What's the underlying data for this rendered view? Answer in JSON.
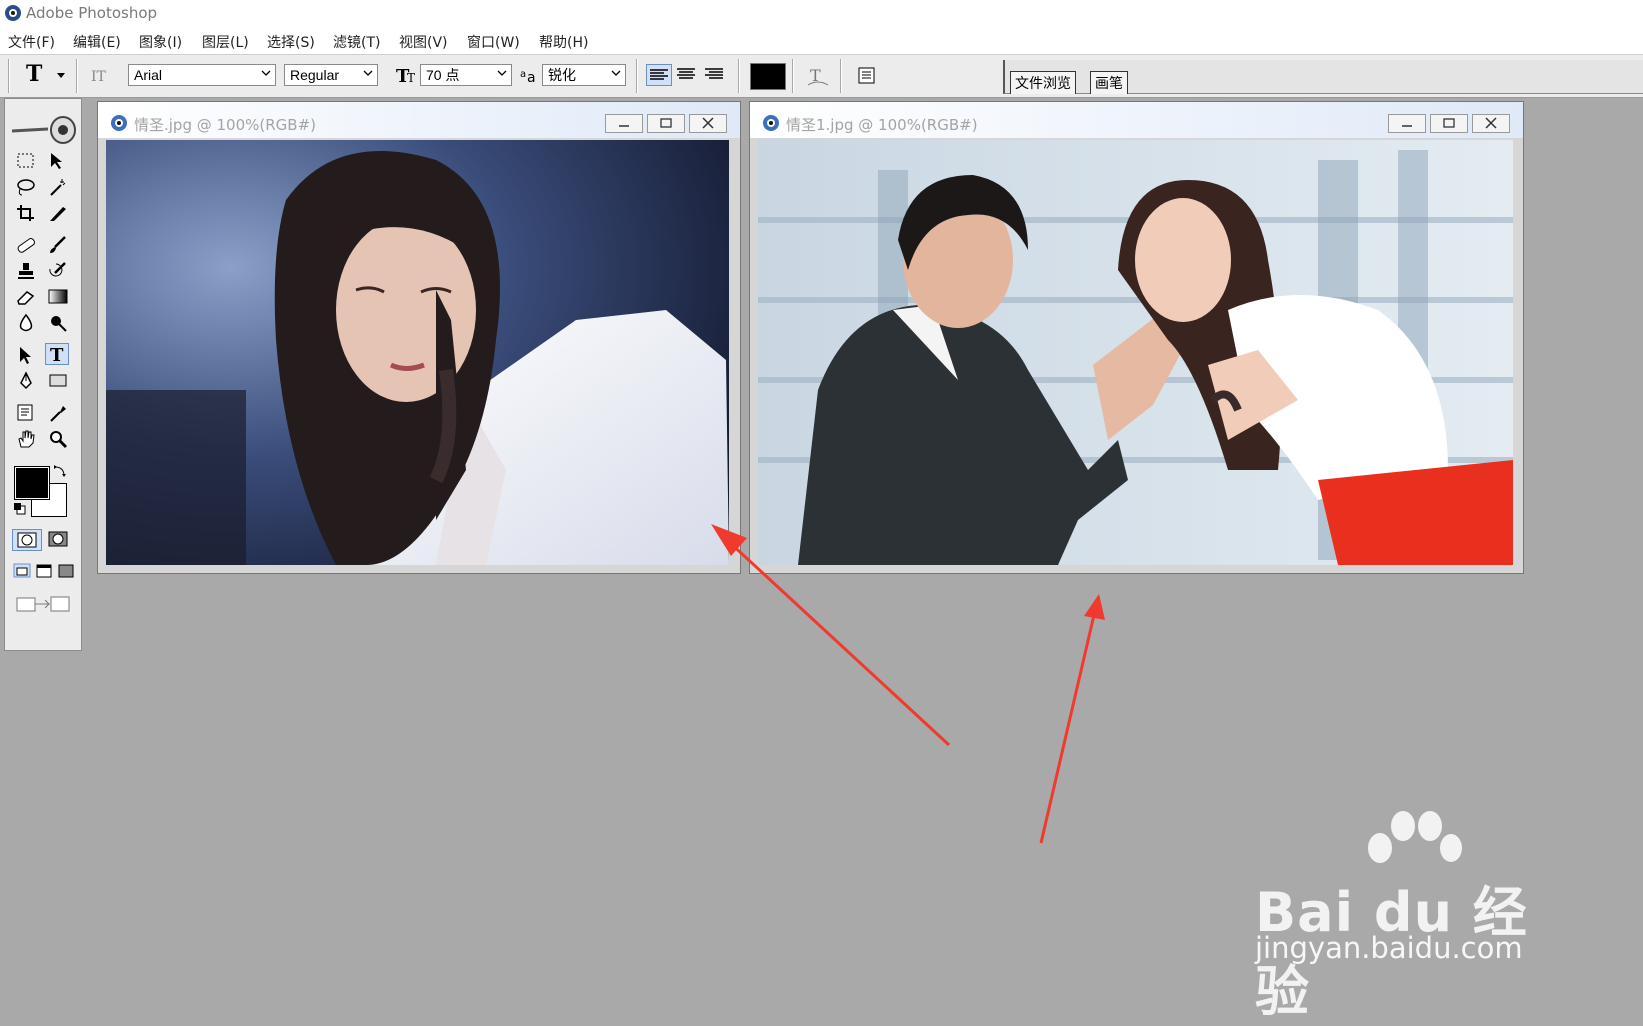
{
  "app": {
    "title": "Adobe Photoshop"
  },
  "menu": [
    {
      "label": "文件(F)"
    },
    {
      "label": "编辑(E)"
    },
    {
      "label": "图象(I)"
    },
    {
      "label": "图层(L)"
    },
    {
      "label": "选择(S)"
    },
    {
      "label": "滤镜(T)"
    },
    {
      "label": "视图(V)"
    },
    {
      "label": "窗口(W)"
    },
    {
      "label": "帮助(H)"
    }
  ],
  "options": {
    "font_family": "Arial",
    "font_style": "Regular",
    "font_size": "70 点",
    "antialias": "锐化",
    "text_color": "#000000"
  },
  "palette_well": {
    "tabs": [
      "文件浏览",
      "画笔"
    ]
  },
  "documents": [
    {
      "title": "情圣.jpg @ 100%(RGB#)"
    },
    {
      "title": "情圣1.jpg @ 100%(RGB#)"
    }
  ],
  "colors": {
    "foreground": "#000000",
    "background": "#ffffff",
    "annotation_arrow": "#f03a2e",
    "workspace": "#a9a9a9"
  },
  "watermark": {
    "brand": "Bai du 经验",
    "url": "jingyan.baidu.com"
  }
}
